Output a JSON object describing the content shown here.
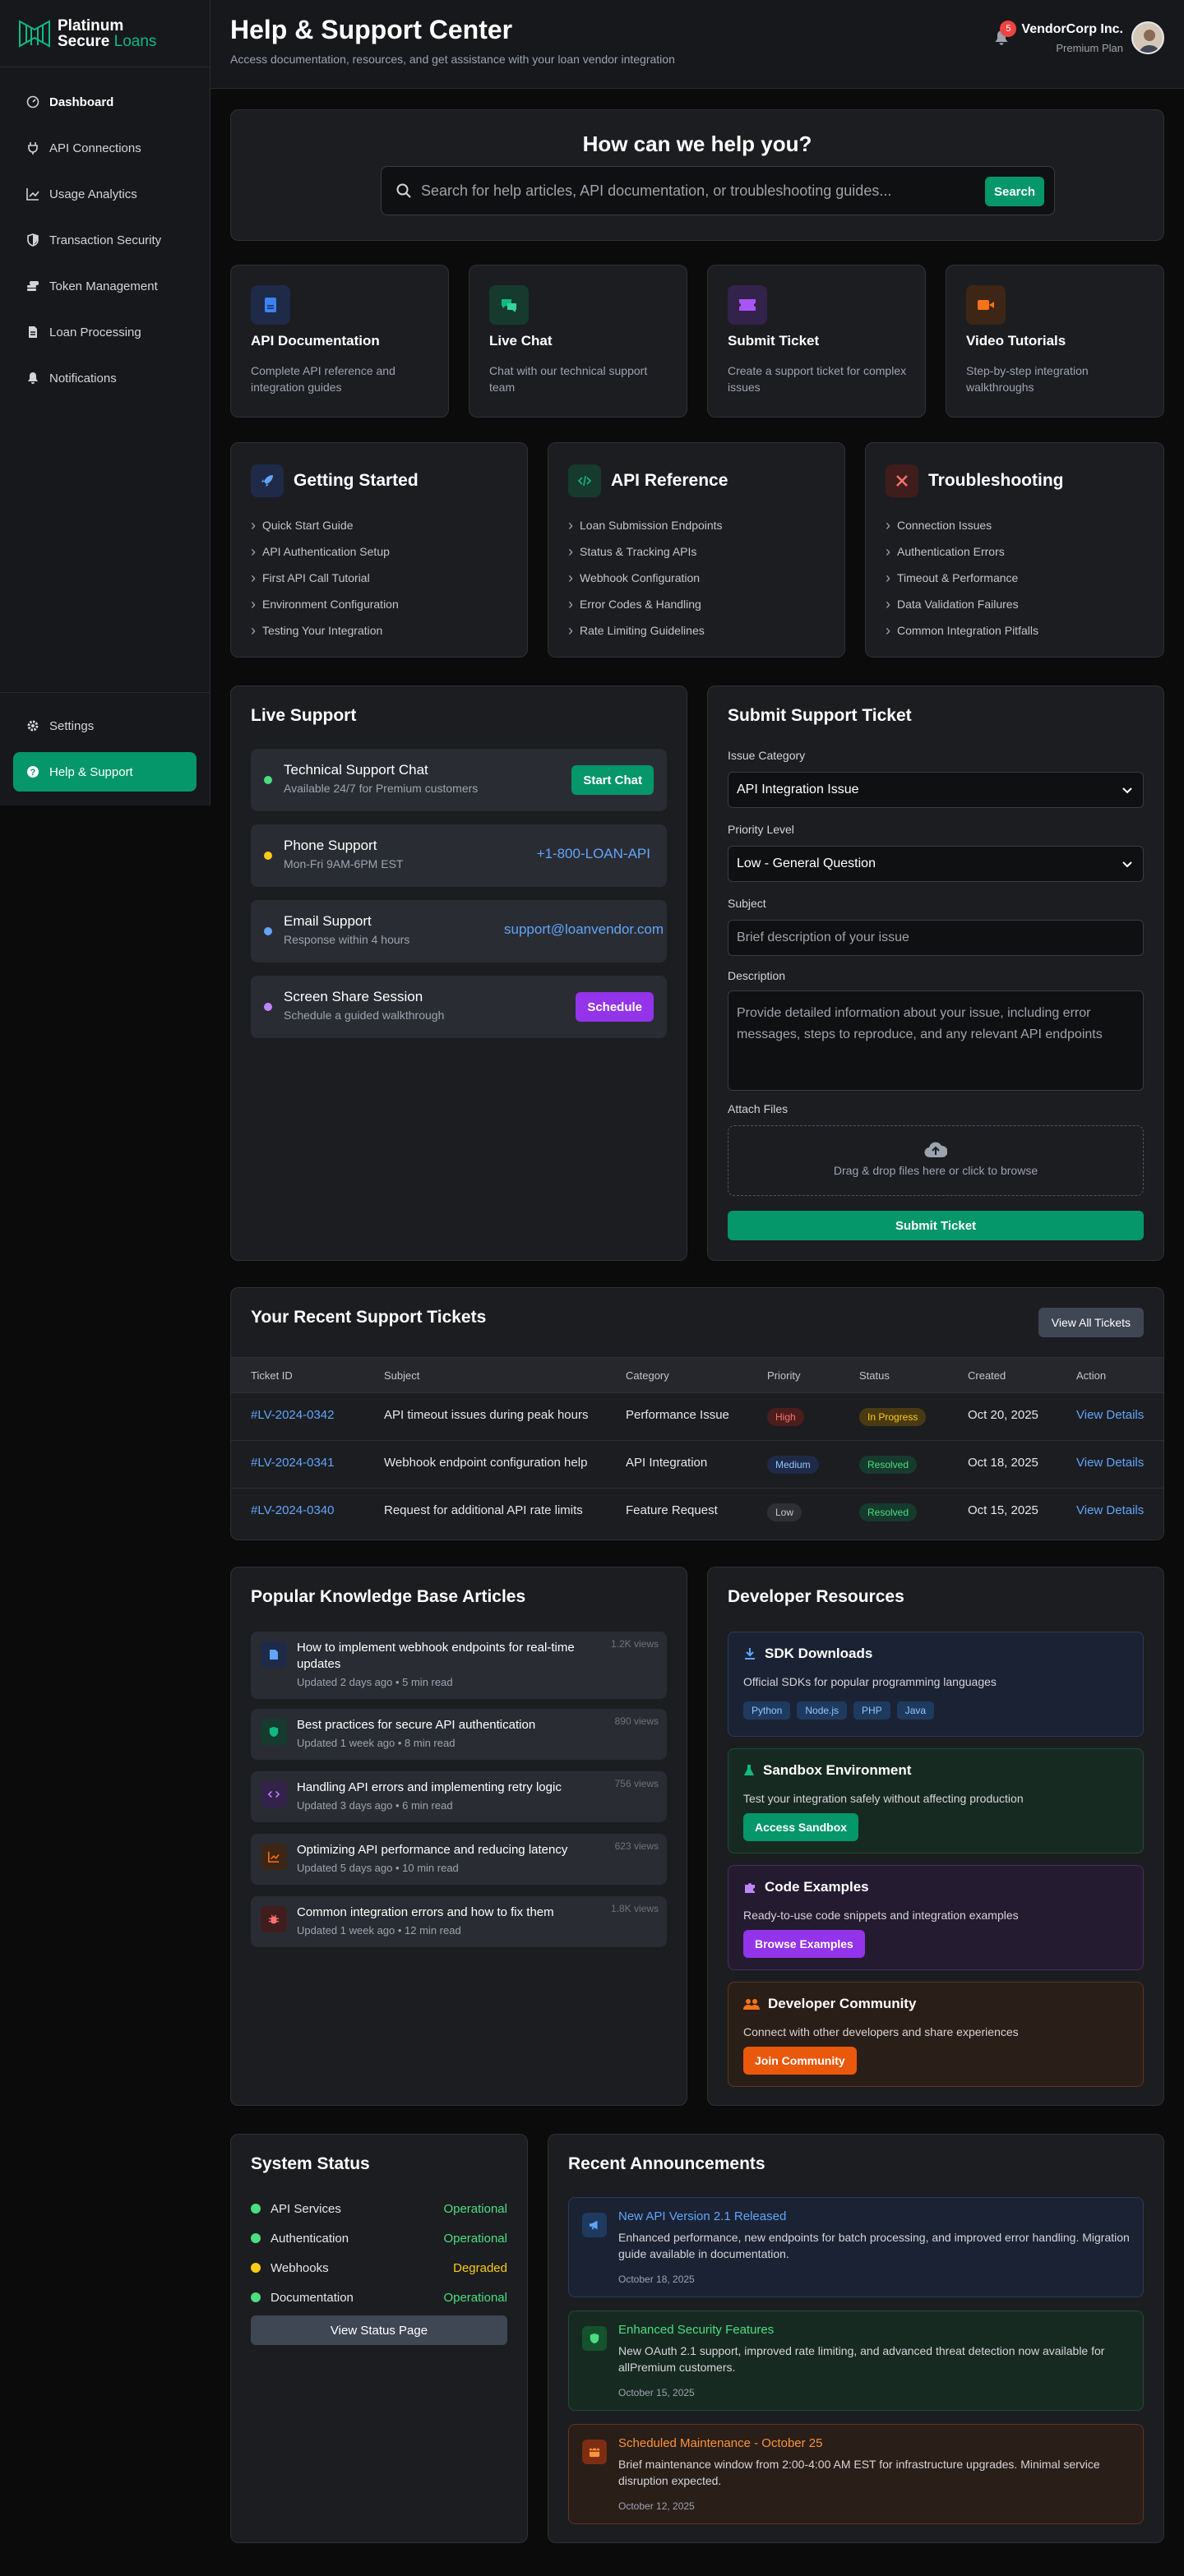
{
  "brand": {
    "line1": "Platinum",
    "line2": "Secure",
    "line2b": "Loans"
  },
  "sidebar": {
    "items": [
      {
        "label": "Dashboard",
        "icon": "dashboard-icon"
      },
      {
        "label": "API Connections",
        "icon": "plug-icon"
      },
      {
        "label": "Usage Analytics",
        "icon": "chart-icon"
      },
      {
        "label": "Transaction Security",
        "icon": "shield-icon"
      },
      {
        "label": "Token Management",
        "icon": "coins-icon"
      },
      {
        "label": "Loan Processing",
        "icon": "file-icon"
      },
      {
        "label": "Notifications",
        "icon": "bell-icon"
      }
    ],
    "settings": "Settings",
    "help": "Help & Support"
  },
  "header": {
    "title": "Help & Support Center",
    "subtitle": "Access documentation, resources, and get assistance with your loan vendor integration",
    "notifications": "5",
    "user_name": "VendorCorp Inc.",
    "user_plan": "Premium Plan"
  },
  "hero": {
    "title": "How can we help you?",
    "placeholder": "Search for help articles, API documentation, or troubleshooting guides...",
    "button": "Search"
  },
  "quick_cards": [
    {
      "title": "API Documentation",
      "desc": "Complete API reference and integration guides",
      "color": "#3b82f6"
    },
    {
      "title": "Live Chat",
      "desc": "Chat with our technical support team",
      "color": "#10b981"
    },
    {
      "title": "Submit Ticket",
      "desc": "Create a support ticket for complex issues",
      "color": "#a855f7"
    },
    {
      "title": "Video Tutorials",
      "desc": "Step-by-step integration walkthroughs",
      "color": "#f97316"
    }
  ],
  "guides": [
    {
      "title": "Getting Started",
      "items": [
        "Quick Start Guide",
        "API Authentication Setup",
        "First API Call Tutorial",
        "Environment Configuration",
        "Testing Your Integration"
      ]
    },
    {
      "title": "API Reference",
      "items": [
        "Loan Submission Endpoints",
        "Status & Tracking APIs",
        "Webhook Configuration",
        "Error Codes & Handling",
        "Rate Limiting Guidelines"
      ]
    },
    {
      "title": "Troubleshooting",
      "items": [
        "Connection Issues",
        "Authentication Errors",
        "Timeout & Performance",
        "Data Validation Failures",
        "Common Integration Pitfalls"
      ]
    }
  ],
  "live_support": {
    "title": "Live Support",
    "items": [
      {
        "name": "Technical Support Chat",
        "sub": "Available 24/7 for Premium customers",
        "action": "Start Chat",
        "dot": "#4ade80"
      },
      {
        "name": "Phone Support",
        "sub": "Mon-Fri 9AM-6PM EST",
        "action": "+1-800-LOAN-API",
        "dot": "#facc15"
      },
      {
        "name": "Email Support",
        "sub": "Response within 4 hours",
        "action": "support@loanvendor.com",
        "dot": "#60a5fa"
      },
      {
        "name": "Screen Share Session",
        "sub": "Schedule a guided walkthrough",
        "action": "Schedule",
        "dot": "#c084fc"
      }
    ]
  },
  "ticket_form": {
    "title": "Submit Support Ticket",
    "category_label": "Issue Category",
    "category_value": "API Integration Issue",
    "priority_label": "Priority Level",
    "priority_value": "Low - General Question",
    "subject_label": "Subject",
    "subject_placeholder": "Brief description of your issue",
    "desc_label": "Description",
    "desc_placeholder": "Provide detailed information about your issue, including error messages, steps to reproduce, and any relevant API endpoints",
    "files_label": "Attach Files",
    "files_hint": "Drag & drop files here or click to browse",
    "submit": "Submit Ticket"
  },
  "tickets": {
    "title": "Your Recent Support Tickets",
    "view_all": "View All Tickets",
    "columns": [
      "Ticket ID",
      "Subject",
      "Category",
      "Priority",
      "Status",
      "Created",
      "Action"
    ],
    "rows": [
      {
        "id": "#LV-2024-0342",
        "subject": "API timeout issues during peak hours",
        "category": "Performance Issue",
        "priority": "High",
        "status": "In Progress",
        "created": "Oct 20, 2025",
        "action": "View Details"
      },
      {
        "id": "#LV-2024-0341",
        "subject": "Webhook endpoint configuration help",
        "category": "API Integration",
        "priority": "Medium",
        "status": "Resolved",
        "created": "Oct 18, 2025",
        "action": "View Details"
      },
      {
        "id": "#LV-2024-0340",
        "subject": "Request for additional API rate limits",
        "category": "Feature Request",
        "priority": "Low",
        "status": "Resolved",
        "created": "Oct 15, 2025",
        "action": "View Details"
      }
    ]
  },
  "kb": {
    "title": "Popular Knowledge Base Articles",
    "articles": [
      {
        "title": "How to implement webhook endpoints for real-time updates",
        "meta": "Updated 2 days ago • 5 min read",
        "views": "1.2K views"
      },
      {
        "title": "Best practices for secure API authentication",
        "meta": "Updated 1 week ago • 8 min read",
        "views": "890 views"
      },
      {
        "title": "Handling API errors and implementing retry logic",
        "meta": "Updated 3 days ago • 6 min read",
        "views": "756 views"
      },
      {
        "title": "Optimizing API performance and reducing latency",
        "meta": "Updated 5 days ago • 10 min read",
        "views": "623 views"
      },
      {
        "title": "Common integration errors and how to fix them",
        "meta": "Updated 1 week ago • 12 min read",
        "views": "1.8K views"
      }
    ]
  },
  "dev": {
    "title": "Developer Resources",
    "sdk": {
      "title": "SDK Downloads",
      "desc": "Official SDKs for popular programming languages",
      "tags": [
        "Python",
        "Node.js",
        "PHP",
        "Java"
      ]
    },
    "sandbox": {
      "title": "Sandbox Environment",
      "desc": "Test your integration safely without affecting production",
      "button": "Access Sandbox"
    },
    "code": {
      "title": "Code Examples",
      "desc": "Ready-to-use code snippets and integration examples",
      "button": "Browse Examples"
    },
    "community": {
      "title": "Developer Community",
      "desc": "Connect with other developers and share experiences",
      "button": "Join Community"
    }
  },
  "status": {
    "title": "System Status",
    "items": [
      {
        "name": "API Services",
        "state": "Operational",
        "color": "#4ade80"
      },
      {
        "name": "Authentication",
        "state": "Operational",
        "color": "#4ade80"
      },
      {
        "name": "Webhooks",
        "state": "Degraded",
        "color": "#facc15"
      },
      {
        "name": "Documentation",
        "state": "Operational",
        "color": "#4ade80"
      }
    ],
    "button": "View Status Page"
  },
  "announcements": {
    "title": "Recent Announcements",
    "items": [
      {
        "title": "New API Version 2.1 Released",
        "desc": "Enhanced performance, new endpoints for batch processing, and improved error handling. Migration guide available in documentation.",
        "date": "October 18, 2025"
      },
      {
        "title": "Enhanced Security Features",
        "desc": "New OAuth 2.1 support, improved rate limiting, and advanced threat detection now available for allPremium customers.",
        "date": "October 15, 2025"
      },
      {
        "title": "Scheduled Maintenance - October 25",
        "desc": "Brief maintenance window from 2:00-4:00 AM EST for infrastructure upgrades. Minimal service disruption expected.",
        "date": "October 12, 2025"
      }
    ]
  }
}
